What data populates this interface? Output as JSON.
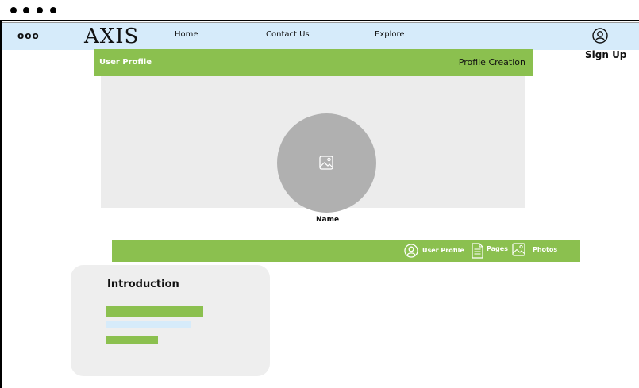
{
  "window": {
    "dots": 4
  },
  "nav": {
    "menu_icon": "ooo",
    "logo": "AXIS",
    "links": [
      "Home",
      "Contact Us",
      "Explore"
    ],
    "user_icon": "user-circle-icon",
    "signup": "Sign Up"
  },
  "profile_header": {
    "title": "User Profile",
    "right_label": "Profile Creation"
  },
  "cover": {
    "avatar_icon": "image-icon",
    "name_label": "Name"
  },
  "tabs": [
    {
      "label": "User Profile",
      "icon": "user-circle-icon"
    },
    {
      "label": "Pages",
      "icon": "document-icon"
    },
    {
      "label": "Photos",
      "icon": "image-icon"
    }
  ],
  "introduction": {
    "title": "Introduction"
  },
  "colors": {
    "accent_green": "#8bc04f",
    "nav_blue": "#d6ebfa",
    "panel_gray": "#ececec",
    "avatar_gray": "#b0b0b0"
  }
}
